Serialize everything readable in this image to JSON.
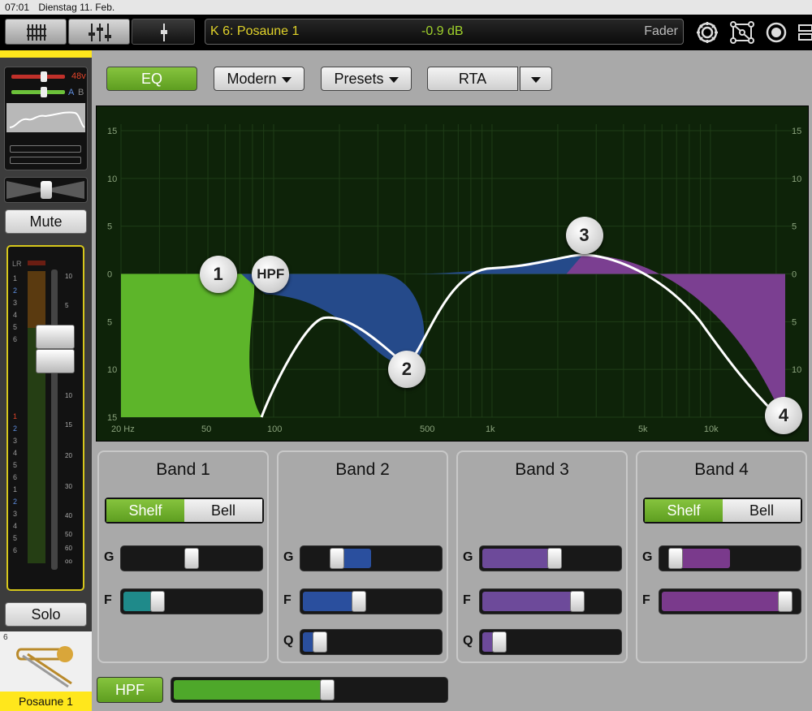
{
  "status": {
    "time": "07:01",
    "date": "Dienstag 11. Feb."
  },
  "header": {
    "channel": "K 6: Posaune 1",
    "value": "-0.9 dB",
    "mode": "Fader",
    "icons": [
      "mixer-view-icon",
      "channel-faders-icon",
      "single-fader-icon",
      "gear-icon",
      "routing-icon",
      "record-icon",
      "layout-icon"
    ]
  },
  "strip": {
    "phantom": "48v",
    "inputs": [
      "A",
      "B"
    ],
    "mute_label": "Mute",
    "solo_label": "Solo",
    "channel_number": "6",
    "channel_name": "Posaune 1",
    "meter_label": "LR",
    "groups": [
      "1",
      "2",
      "3",
      "4",
      "5",
      "6",
      "1",
      "2",
      "3",
      "4",
      "5",
      "6",
      "1",
      "2",
      "3",
      "4",
      "5",
      "6"
    ],
    "scale": [
      "10",
      "5",
      "U",
      "5",
      "10",
      "15",
      "20",
      "30",
      "40",
      "50",
      "60",
      "oo"
    ]
  },
  "eq": {
    "toggle_label": "EQ",
    "mode_label": "Modern",
    "presets_label": "Presets",
    "rta_label": "RTA",
    "db_ticks": [
      "15",
      "10",
      "5",
      "0",
      "5",
      "10",
      "15"
    ],
    "freq_ticks": [
      {
        "label": "20 Hz",
        "f": 20
      },
      {
        "label": "50",
        "f": 50
      },
      {
        "label": "100",
        "f": 100
      },
      {
        "label": "500",
        "f": 500
      },
      {
        "label": "1k",
        "f": 1000
      },
      {
        "label": "5k",
        "f": 5000
      },
      {
        "label": "10k",
        "f": 10000
      }
    ],
    "nodes": [
      {
        "label": "1",
        "f": 52,
        "gain": 0
      },
      {
        "label": "HPF",
        "f": 92,
        "gain": 0
      },
      {
        "label": "2",
        "f": 400,
        "gain": -9.5
      },
      {
        "label": "3",
        "f": 2600,
        "gain": 2
      },
      {
        "label": "4",
        "f": 18000,
        "gain": -15
      }
    ],
    "colors": {
      "band1": "#5db52a",
      "band2": "#254a8a",
      "band3": "#7b3f91",
      "curve": "#ffffff",
      "background": "#0e2309"
    }
  },
  "bands": [
    {
      "title": "Band 1",
      "toggle": [
        "Shelf",
        "Bell"
      ],
      "params": [
        {
          "label": "G",
          "value": 0.5
        },
        {
          "label": "F",
          "value": 0.22,
          "color": "#1f8a8a"
        }
      ]
    },
    {
      "title": "Band 2",
      "params": [
        {
          "label": "G",
          "value": 0.22,
          "color": "#2a4f9e",
          "from": 0.22,
          "to": 0.5
        },
        {
          "label": "F",
          "value": 0.4,
          "color": "#2a4f9e"
        },
        {
          "label": "Q",
          "value": 0.08,
          "color": "#2a4f9e"
        }
      ]
    },
    {
      "title": "Band 3",
      "params": [
        {
          "label": "G",
          "value": 0.53,
          "color": "#6d4a9a"
        },
        {
          "label": "F",
          "value": 0.72,
          "color": "#6d4a9a"
        },
        {
          "label": "Q",
          "value": 0.08,
          "color": "#6d4a9a"
        }
      ]
    },
    {
      "title": "Band 4",
      "toggle": [
        "Shelf",
        "Bell"
      ],
      "params": [
        {
          "label": "G",
          "value": 0.05,
          "color": "#7a3a8c",
          "from": 0.05,
          "to": 0.5
        },
        {
          "label": "F",
          "value": 0.95,
          "color": "#7a3a8c"
        }
      ]
    }
  ],
  "hpf": {
    "label": "HPF",
    "value": 0.57
  }
}
